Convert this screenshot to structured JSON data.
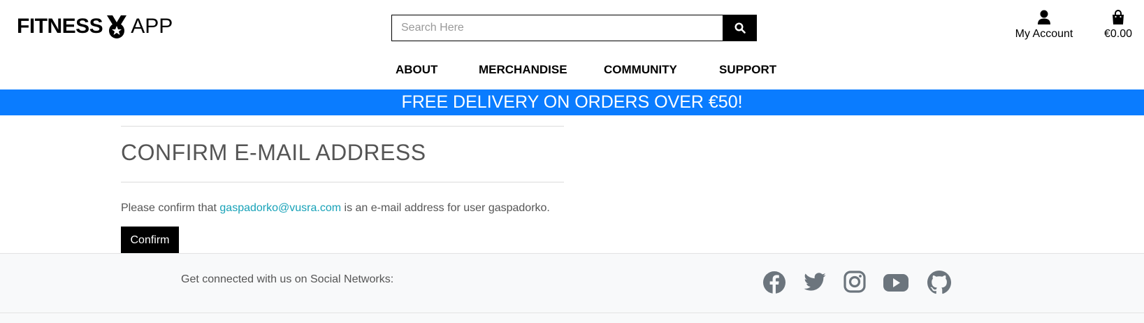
{
  "header": {
    "logo": {
      "word1": "FITNESS",
      "word2": "APP"
    },
    "search": {
      "placeholder": "Search Here"
    },
    "account_label": "My Account",
    "cart_total": "€0.00"
  },
  "nav": {
    "items": [
      "ABOUT",
      "MERCHANDISE",
      "COMMUNITY",
      "SUPPORT"
    ]
  },
  "banner": {
    "text": "FREE DELIVERY ON ORDERS OVER €50!"
  },
  "main": {
    "title": "CONFIRM E-MAIL ADDRESS",
    "message_before": "Please confirm that ",
    "email": "gaspadorko@vusra.com",
    "message_after": " is an e-mail address for user gaspadorko.",
    "confirm_label": "Confirm"
  },
  "footer": {
    "social_label": "Get connected with us on Social Networks:",
    "social_icons": [
      "facebook-icon",
      "twitter-icon",
      "instagram-icon",
      "youtube-icon",
      "github-icon"
    ]
  },
  "colors": {
    "banner": "#0a7cff",
    "link": "#17a2b8",
    "button": "#000000",
    "footer_bg": "#f8f9fa"
  }
}
